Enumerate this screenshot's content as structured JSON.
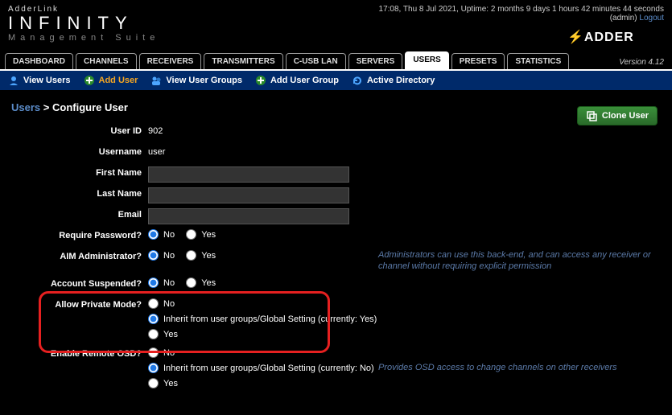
{
  "header": {
    "logo_pre": "AdderLink",
    "logo_main": "INFINITY",
    "logo_sub": "Management Suite",
    "time_status": "17:08, Thu 8 Jul 2021,  Uptime: 2 months 9 days 1 hours 42 minutes 44 seconds",
    "user_label": "(admin)",
    "logout": "Logout",
    "brand": "ADDER"
  },
  "tabs": {
    "dashboard": "DASHBOARD",
    "channels": "CHANNELS",
    "receivers": "RECEIVERS",
    "transmitters": "TRANSMITTERS",
    "cusb": "C-USB LAN",
    "servers": "SERVERS",
    "users": "USERS",
    "presets": "PRESETS",
    "statistics": "STATISTICS",
    "version": "Version 4.12"
  },
  "subnav": {
    "view_users": "View Users",
    "add_user": "Add User",
    "view_groups": "View User Groups",
    "add_group": "Add User Group",
    "active_dir": "Active Directory"
  },
  "breadcrumb": {
    "root": "Users",
    "sep": ">",
    "page": "Configure User"
  },
  "clone": "Clone User",
  "form": {
    "user_id_label": "User ID",
    "user_id": "902",
    "username_label": "Username",
    "username": "user",
    "first_name_label": "First Name",
    "first_name": "",
    "last_name_label": "Last Name",
    "last_name": "",
    "email_label": "Email",
    "email": "",
    "require_pw_label": "Require Password?",
    "aim_admin_label": "AIM Administrator?",
    "suspended_label": "Account Suspended?",
    "private_label": "Allow Private Mode?",
    "remote_osd_label": "Enable Remote OSD?",
    "opt_no": "No",
    "opt_yes": "Yes",
    "opt_inherit_yes": "Inherit from user groups/Global Setting (currently: Yes)",
    "opt_inherit_no": "Inherit from user groups/Global Setting (currently: No)"
  },
  "hints": {
    "admin": "Administrators can use this back-end, and can access any receiver or channel without requiring explicit permission",
    "osd": "Provides OSD access to change channels on other receivers"
  }
}
